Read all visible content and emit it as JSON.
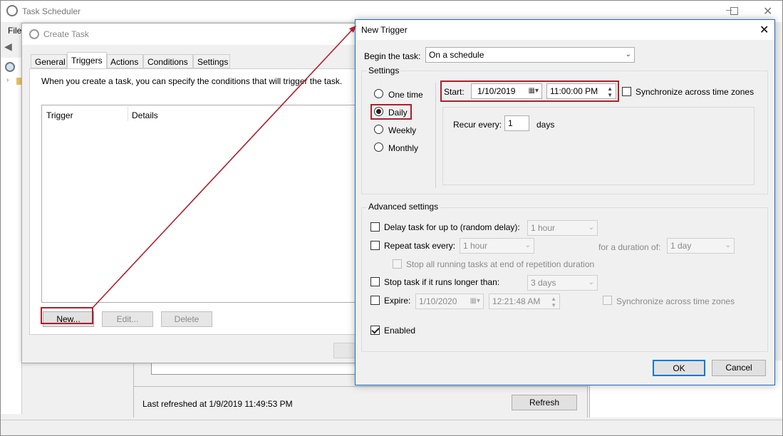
{
  "task_scheduler": {
    "title": "Task Scheduler",
    "menu_file": "File",
    "last_refreshed": "Last refreshed at 1/9/2019 11:49:53 PM",
    "refresh_button": "Refresh"
  },
  "create_task": {
    "title": "Create Task",
    "tabs": [
      "General",
      "Triggers",
      "Actions",
      "Conditions",
      "Settings"
    ],
    "active_tab": "Triggers",
    "description": "When you create a task, you can specify the conditions that will trigger the task.",
    "columns": [
      "Trigger",
      "Details"
    ],
    "buttons": {
      "new": "New...",
      "edit": "Edit...",
      "delete": "Delete"
    }
  },
  "new_trigger": {
    "title": "New Trigger",
    "begin_label": "Begin the task:",
    "begin_value": "On a schedule",
    "settings_label": "Settings",
    "schedule_options": [
      "One time",
      "Daily",
      "Weekly",
      "Monthly"
    ],
    "selected_schedule": "Daily",
    "start_label": "Start:",
    "start_date": "1/10/2019",
    "start_time": "11:00:00 PM",
    "sync_label": "Synchronize across time zones",
    "recur_label": "Recur every:",
    "recur_value": "1",
    "recur_unit": "days",
    "advanced_label": "Advanced settings",
    "delay_label": "Delay task for up to (random delay):",
    "delay_value": "1 hour",
    "repeat_label": "Repeat task every:",
    "repeat_value": "1 hour",
    "duration_label": "for a duration of:",
    "duration_value": "1 day",
    "stop_all_label": "Stop all running tasks at end of repetition duration",
    "stop_label": "Stop task if it runs longer than:",
    "stop_value": "3 days",
    "expire_label": "Expire:",
    "expire_date": "1/10/2020",
    "expire_time": "12:21:48 AM",
    "expire_sync_label": "Synchronize across time zones",
    "enabled_label": "Enabled",
    "ok_button": "OK",
    "cancel_button": "Cancel"
  },
  "colors": {
    "highlight": "#b01e2a",
    "focus": "#0078d7",
    "window_bg": "#f0f0f0"
  }
}
